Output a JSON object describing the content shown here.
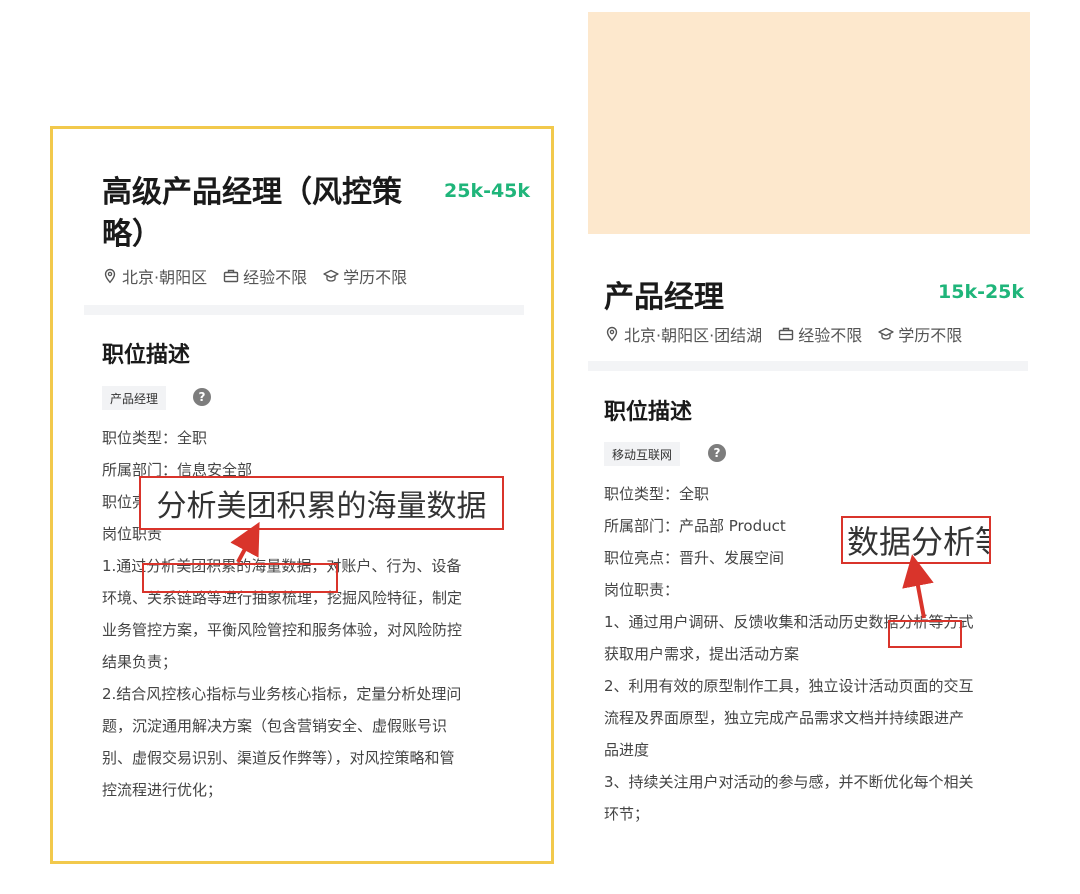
{
  "left": {
    "title": "高级产品经理（风控策略）",
    "salary": "25k-45k",
    "location": "北京·朝阳区",
    "experience": "经验不限",
    "education": "学历不限",
    "section_title": "职位描述",
    "tag": "产品经理",
    "help": "?",
    "lines": [
      "职位类型：全职",
      "所属部门：信息安全部",
      "职位亮",
      "岗位职责",
      "1.通过分析美团积累的海量数据，对账户、行为、设备",
      "环境、关系链路等进行抽象梳理，挖掘风险特征，制定",
      "业务管控方案，平衡风险管控和服务体验，对风险防控",
      "结果负责；",
      "2.结合风控核心指标与业务核心指标，定量分析处理问",
      "题，沉淀通用解决方案（包含营销安全、虚假账号识",
      "别、虚假交易识别、渠道反作弊等），对风控策略和管",
      "控流程进行优化；"
    ],
    "zoom_text": "分析美团积累的海量数据"
  },
  "right": {
    "title": "产品经理",
    "salary": "15k-25k",
    "location": "北京·朝阳区·团结湖",
    "experience": "经验不限",
    "education": "学历不限",
    "section_title": "职位描述",
    "tag": "移动互联网",
    "help": "?",
    "lines": [
      "职位类型：全职",
      "所属部门：产品部 Product",
      "职位亮点：晋升、发展空间",
      "岗位职责：",
      "1、通过用户调研、反馈收集和活动历史数据分析等方式",
      "获取用户需求，提出活动方案",
      "2、利用有效的原型制作工具，独立设计活动页面的交互",
      "流程及界面原型，独立完成产品需求文档并持续跟进产",
      "品进度",
      "3、持续关注用户对活动的参与感，并不断优化每个相关",
      "环节；"
    ],
    "zoom_text": "数据分析等"
  },
  "colors": {
    "accent_green": "#1fb57a",
    "highlight_red": "#d9342b",
    "frame_yellow": "#f2c94c",
    "peach": "#fde8cd"
  },
  "icons": [
    "location-pin-icon",
    "briefcase-icon",
    "graduation-cap-icon",
    "help-icon",
    "arrow-icon"
  ]
}
